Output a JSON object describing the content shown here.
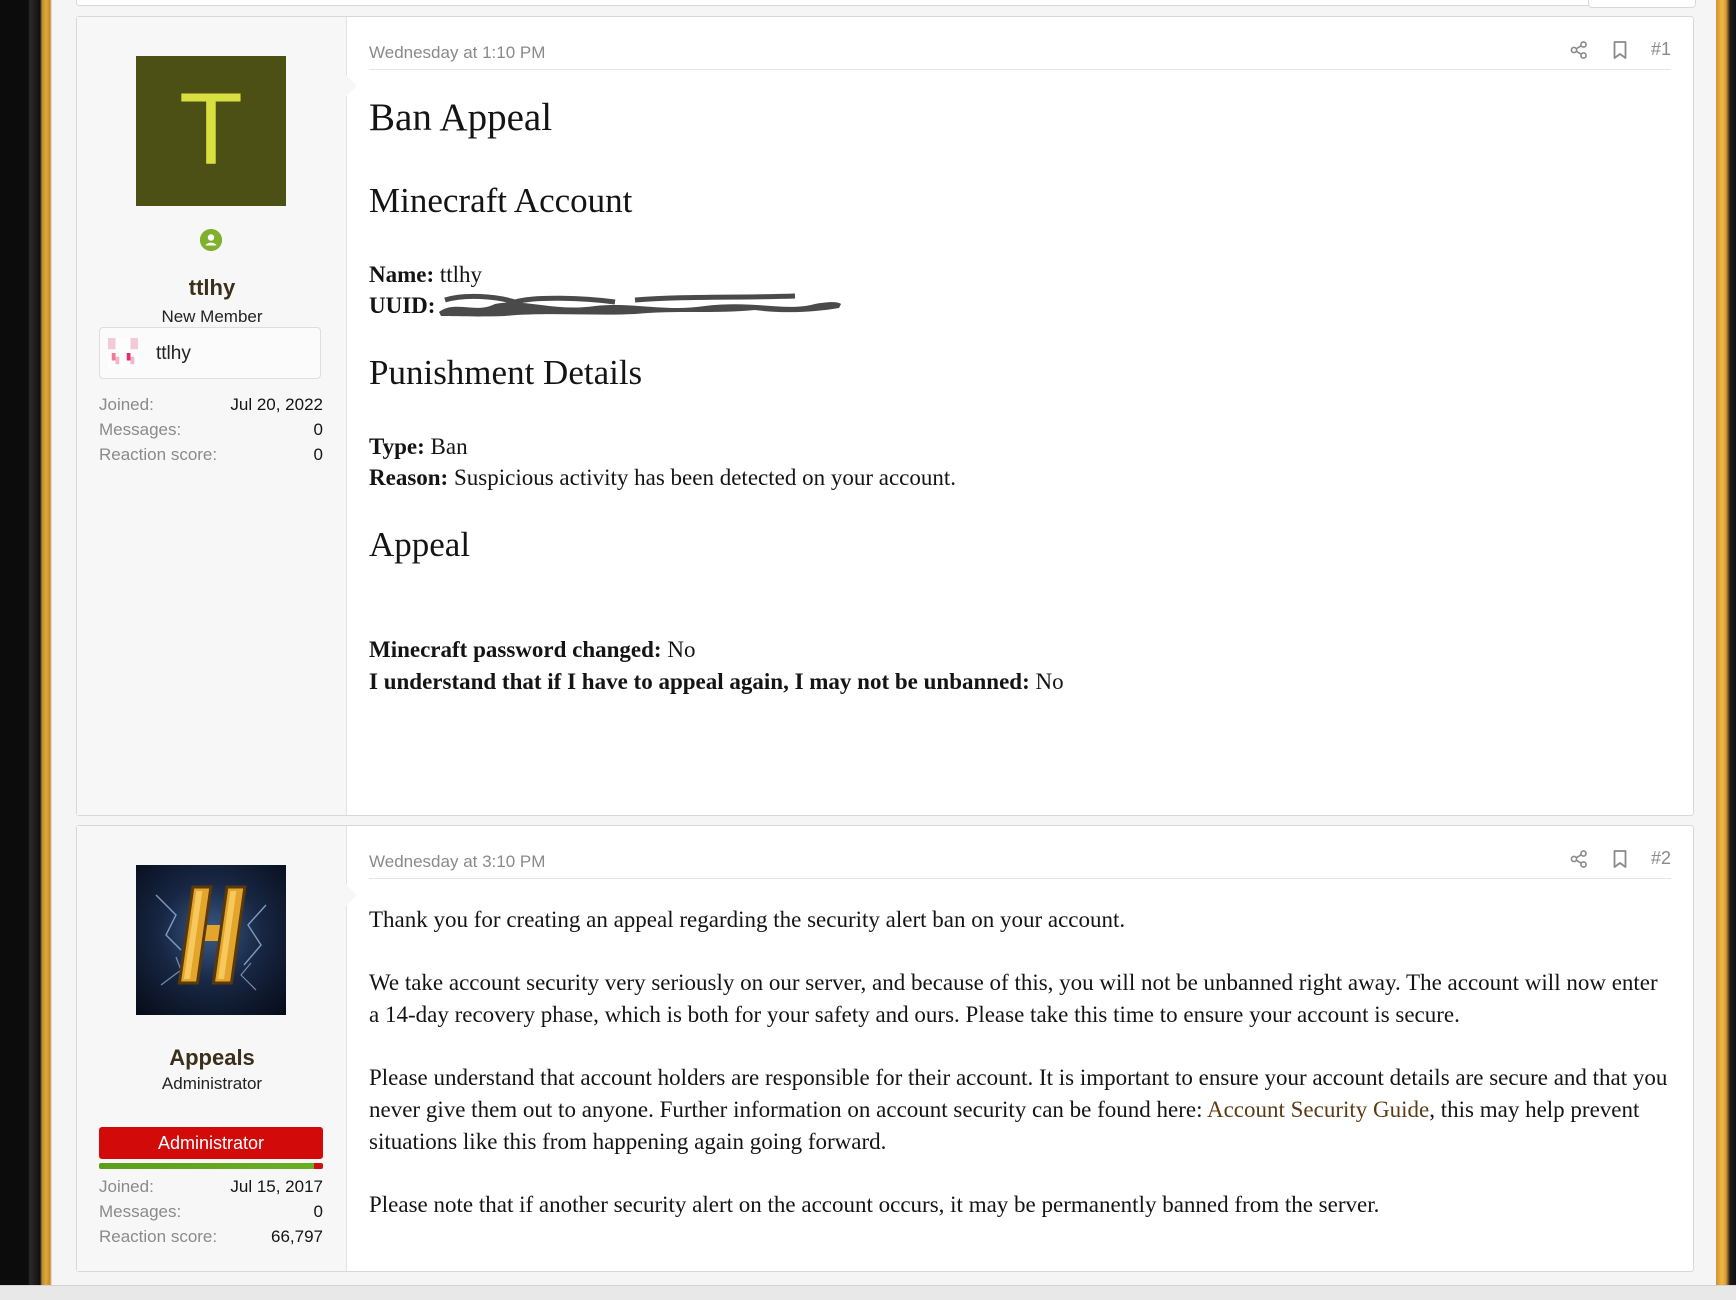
{
  "post1": {
    "date": "Wednesday at 1:10 PM",
    "number": "#1",
    "user": {
      "avatar_letter": "T",
      "username": "ttlhy",
      "user_title": "New Member",
      "minecraft_name": "ttlhy",
      "stats": [
        {
          "label": "Joined:",
          "value": "Jul 20, 2022"
        },
        {
          "label": "Messages:",
          "value": "0"
        },
        {
          "label": "Reaction score:",
          "value": "0"
        }
      ]
    },
    "content": {
      "title": "Ban Appeal",
      "section_account": "Minecraft Account",
      "name_label": "Name:",
      "name_value": "ttlhy",
      "uuid_label": "UUID:",
      "section_punishment": "Punishment Details",
      "type_label": "Type:",
      "type_value": "Ban",
      "reason_label": "Reason:",
      "reason_value": "Suspicious activity has been detected on your account.",
      "section_appeal": "Appeal",
      "pw_label": "Minecraft password changed:",
      "pw_value": "No",
      "understand_label": "I understand that if I have to appeal again, I may not be unbanned:",
      "understand_value": "No"
    }
  },
  "post2": {
    "date": "Wednesday at 3:10 PM",
    "number": "#2",
    "user": {
      "username": "Appeals",
      "user_title": "Administrator",
      "banner": "Administrator",
      "stats": [
        {
          "label": "Joined:",
          "value": "Jul 15, 2017"
        },
        {
          "label": "Messages:",
          "value": "0"
        },
        {
          "label": "Reaction score:",
          "value": "66,797"
        }
      ]
    },
    "content": {
      "p1": "Thank you for creating an appeal regarding the security alert ban on your account.",
      "p2": "We take account security very seriously on our server, and because of this, you will not be unbanned right away. The account will now enter a 14-day recovery phase, which is both for your safety and ours. Please take this time to ensure your account is secure.",
      "p3_before": "Please understand that account holders are responsible for their account. It is important to ensure your account details are secure and that you never give them out to anyone. Further information on account security can be found here: ",
      "p3_link": "Account Security Guide",
      "p3_after": ", this may help prevent situations like this from happening again going forward.",
      "p4": "Please note that if another security alert on the account occurs, it may be permanently banned from the server."
    }
  },
  "icons": {
    "share": "share-icon",
    "bookmark": "bookmark-icon",
    "online": "online-user-icon"
  },
  "colors": {
    "avatar_bg": "#4c5015",
    "avatar_letter": "#d9df3f",
    "admin_banner": "#d20a0a",
    "online": "#7fb02e",
    "link": "#5b3b14"
  }
}
